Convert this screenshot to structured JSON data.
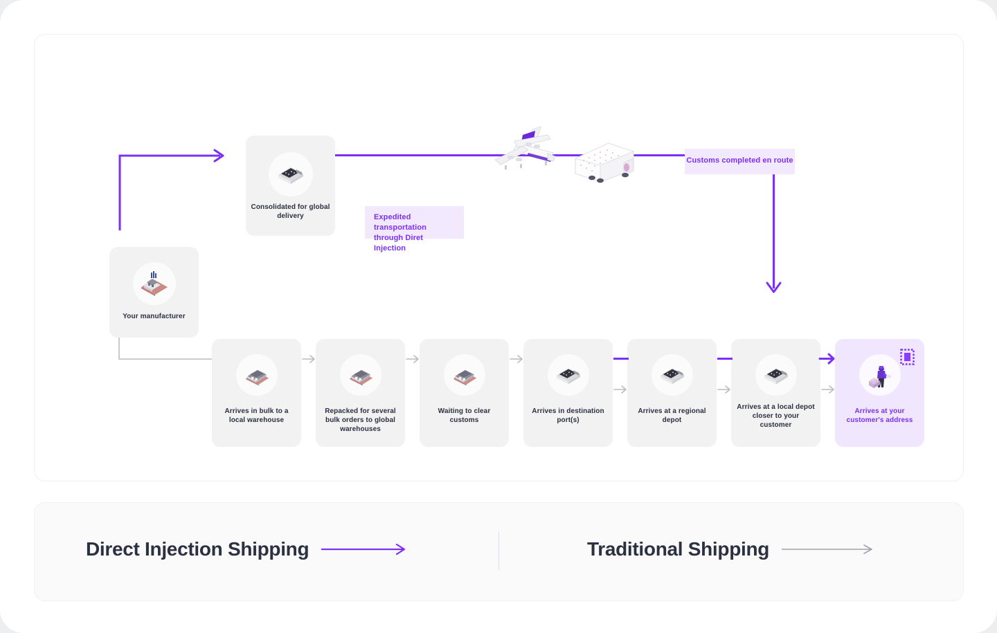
{
  "diagram": {
    "nodes": {
      "manufacturer": {
        "label": "Your manufacturer",
        "icon": "factory-icon"
      },
      "consolidated": {
        "label": "Consolidated for global delivery",
        "icon": "cargo-depot-icon"
      }
    },
    "badges": {
      "expedited": "Expedited transportation through Diret Injection",
      "customs": "Customs completed en route"
    },
    "transit_icons": {
      "plane": "cargo-plane-icon",
      "truck": "semi-truck-icon"
    },
    "steps": [
      {
        "label": "Arrives in bulk to a local warehouse",
        "icon": "warehouse-icon",
        "highlight": false
      },
      {
        "label": "Repacked for several bulk orders to global warehouses",
        "icon": "warehouse-icon",
        "highlight": false
      },
      {
        "label": "Waiting to clear customs",
        "icon": "warehouse-icon",
        "highlight": false
      },
      {
        "label": "Arrives in destination port(s)",
        "icon": "cargo-depot-icon",
        "highlight": false
      },
      {
        "label": "Arrives at a regional depot",
        "icon": "cargo-depot-icon",
        "highlight": false
      },
      {
        "label": "Arrives at a local depot closer to your customer",
        "icon": "cargo-depot-icon",
        "highlight": false
      },
      {
        "label": "Arrives at your customer's address",
        "icon": "delivery-person-icon",
        "highlight": true,
        "badge_icon": "stamp-icon"
      }
    ]
  },
  "legend": {
    "direct": {
      "label": "Direct Injection Shipping",
      "arrow": "arrow-right-icon"
    },
    "traditional": {
      "label": "Traditional Shipping",
      "arrow": "arrow-right-icon"
    }
  },
  "colors": {
    "accent": "#7b2ff7",
    "accent_soft": "#f3e9fe",
    "card": "#f2f2f3",
    "grey_line": "#b9bcc4",
    "text": "#2b3040"
  }
}
